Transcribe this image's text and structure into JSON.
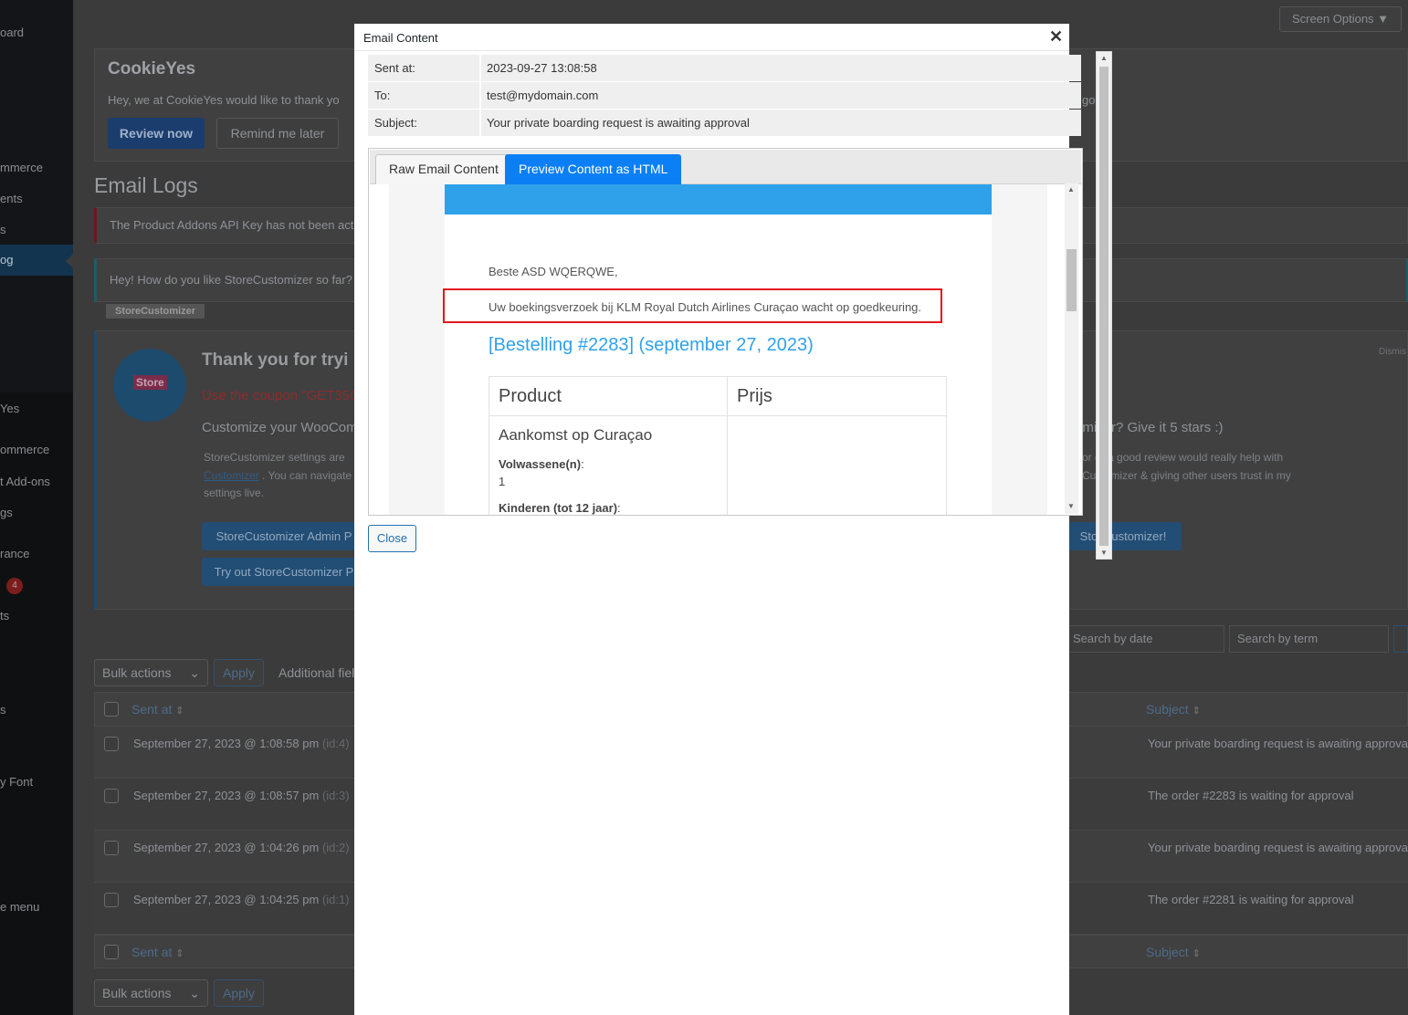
{
  "sidebar": {
    "items": [
      {
        "label": "oard"
      },
      {
        "label": "mmerce"
      },
      {
        "label": "ents"
      },
      {
        "label": "s"
      },
      {
        "label": "og"
      },
      {
        "label": "Yes"
      },
      {
        "label": "ommerce"
      },
      {
        "label": "t Add-ons"
      },
      {
        "label": "gs"
      },
      {
        "label": "rance"
      },
      {
        "label": "ts"
      },
      {
        "label": "s"
      },
      {
        "label": "y Font"
      },
      {
        "label": "e menu"
      }
    ],
    "badge": "4"
  },
  "background": {
    "screen_options": "Screen Options ▼",
    "cookieyes": {
      "logo": "CookieYes",
      "text": "Hey, we at CookieYes would like to thank yo",
      "text_tail": "go.",
      "review_button": "Review now",
      "remind_button": "Remind me later"
    },
    "page_title": "Email Logs",
    "notice_addons": "The Product Addons API Key has not been acti",
    "notice_storecustomizer": "Hey! How do you like StoreCustomizer so far?",
    "storecustomizer_tag": "StoreCustomizer",
    "sc_card": {
      "logo_text": "Store",
      "heading": "Thank you for tryi",
      "coupon": "Use the coupon \"GET35C",
      "customize": "Customize your WooCom",
      "right_prompt": "omizer? Give it 5 stars :)",
      "settings_line1": "StoreCustomizer settings are",
      "settings_link": "Customizer",
      "settings_line2": ". You can navigate",
      "settings_line3": "settings live.",
      "right_line1": "or   er a good review would really help with",
      "right_line2": "Customizer & giving other users trust in my",
      "admin_button": "StoreCustomizer Admin P",
      "try_button": "Try out StoreCustomizer P",
      "right_button": "Store  ustomizer!",
      "dismiss": "Dismis"
    },
    "bulk_actions": "Bulk actions",
    "apply": "Apply",
    "additional_fields": "Additional fiel",
    "search_date_placeholder": "Search by date",
    "search_term_placeholder": "Search by term",
    "columns": {
      "sent_at": "Sent at",
      "subject": "Subject"
    },
    "rows": [
      {
        "date": "September 27, 2023 @ 1:08:58 pm",
        "id": "(id:4)",
        "subject": "Your private boarding request is awaiting approva"
      },
      {
        "date": "September 27, 2023 @ 1:08:57 pm",
        "id": "(id:3)",
        "subject": "The order #2283 is waiting for approval"
      },
      {
        "date": "September 27, 2023 @ 1:04:26 pm",
        "id": "(id:2)",
        "subject": "Your private boarding request is awaiting approva"
      },
      {
        "date": "September 27, 2023 @ 1:04:25 pm",
        "id": "(id:1)",
        "subject": "The order #2281 is waiting for approval"
      }
    ]
  },
  "modal": {
    "title": "Email Content",
    "close_icon": "✕",
    "meta": {
      "sent_at_label": "Sent at:",
      "sent_at_value": "2023-09-27 13:08:58",
      "to_label": "To:",
      "to_value": "test@mydomain.com",
      "subject_label": "Subject:",
      "subject_value": "Your private boarding request is awaiting approval"
    },
    "tabs": {
      "raw": "Raw Email Content",
      "preview": "Preview Content as HTML"
    },
    "email": {
      "greeting": "Beste ASD WQERQWE,",
      "message": "Uw boekingsverzoek bij KLM Royal Dutch Airlines Curaçao wacht op goedkeuring.",
      "order_heading": "[Bestelling #2283] (september 27, 2023)",
      "table_headers": [
        "Product",
        "Prijs"
      ],
      "product_name": "Aankomst op Curaçao",
      "adults_label": "Volwassene(n)",
      "adults_value": "1",
      "children_label": "Kinderen (tot 12 jaar)"
    },
    "close_button": "Close"
  },
  "colors": {
    "accent": "#0b7ff5",
    "email_header": "#2fa1ea",
    "highlight": "#e3171d"
  }
}
